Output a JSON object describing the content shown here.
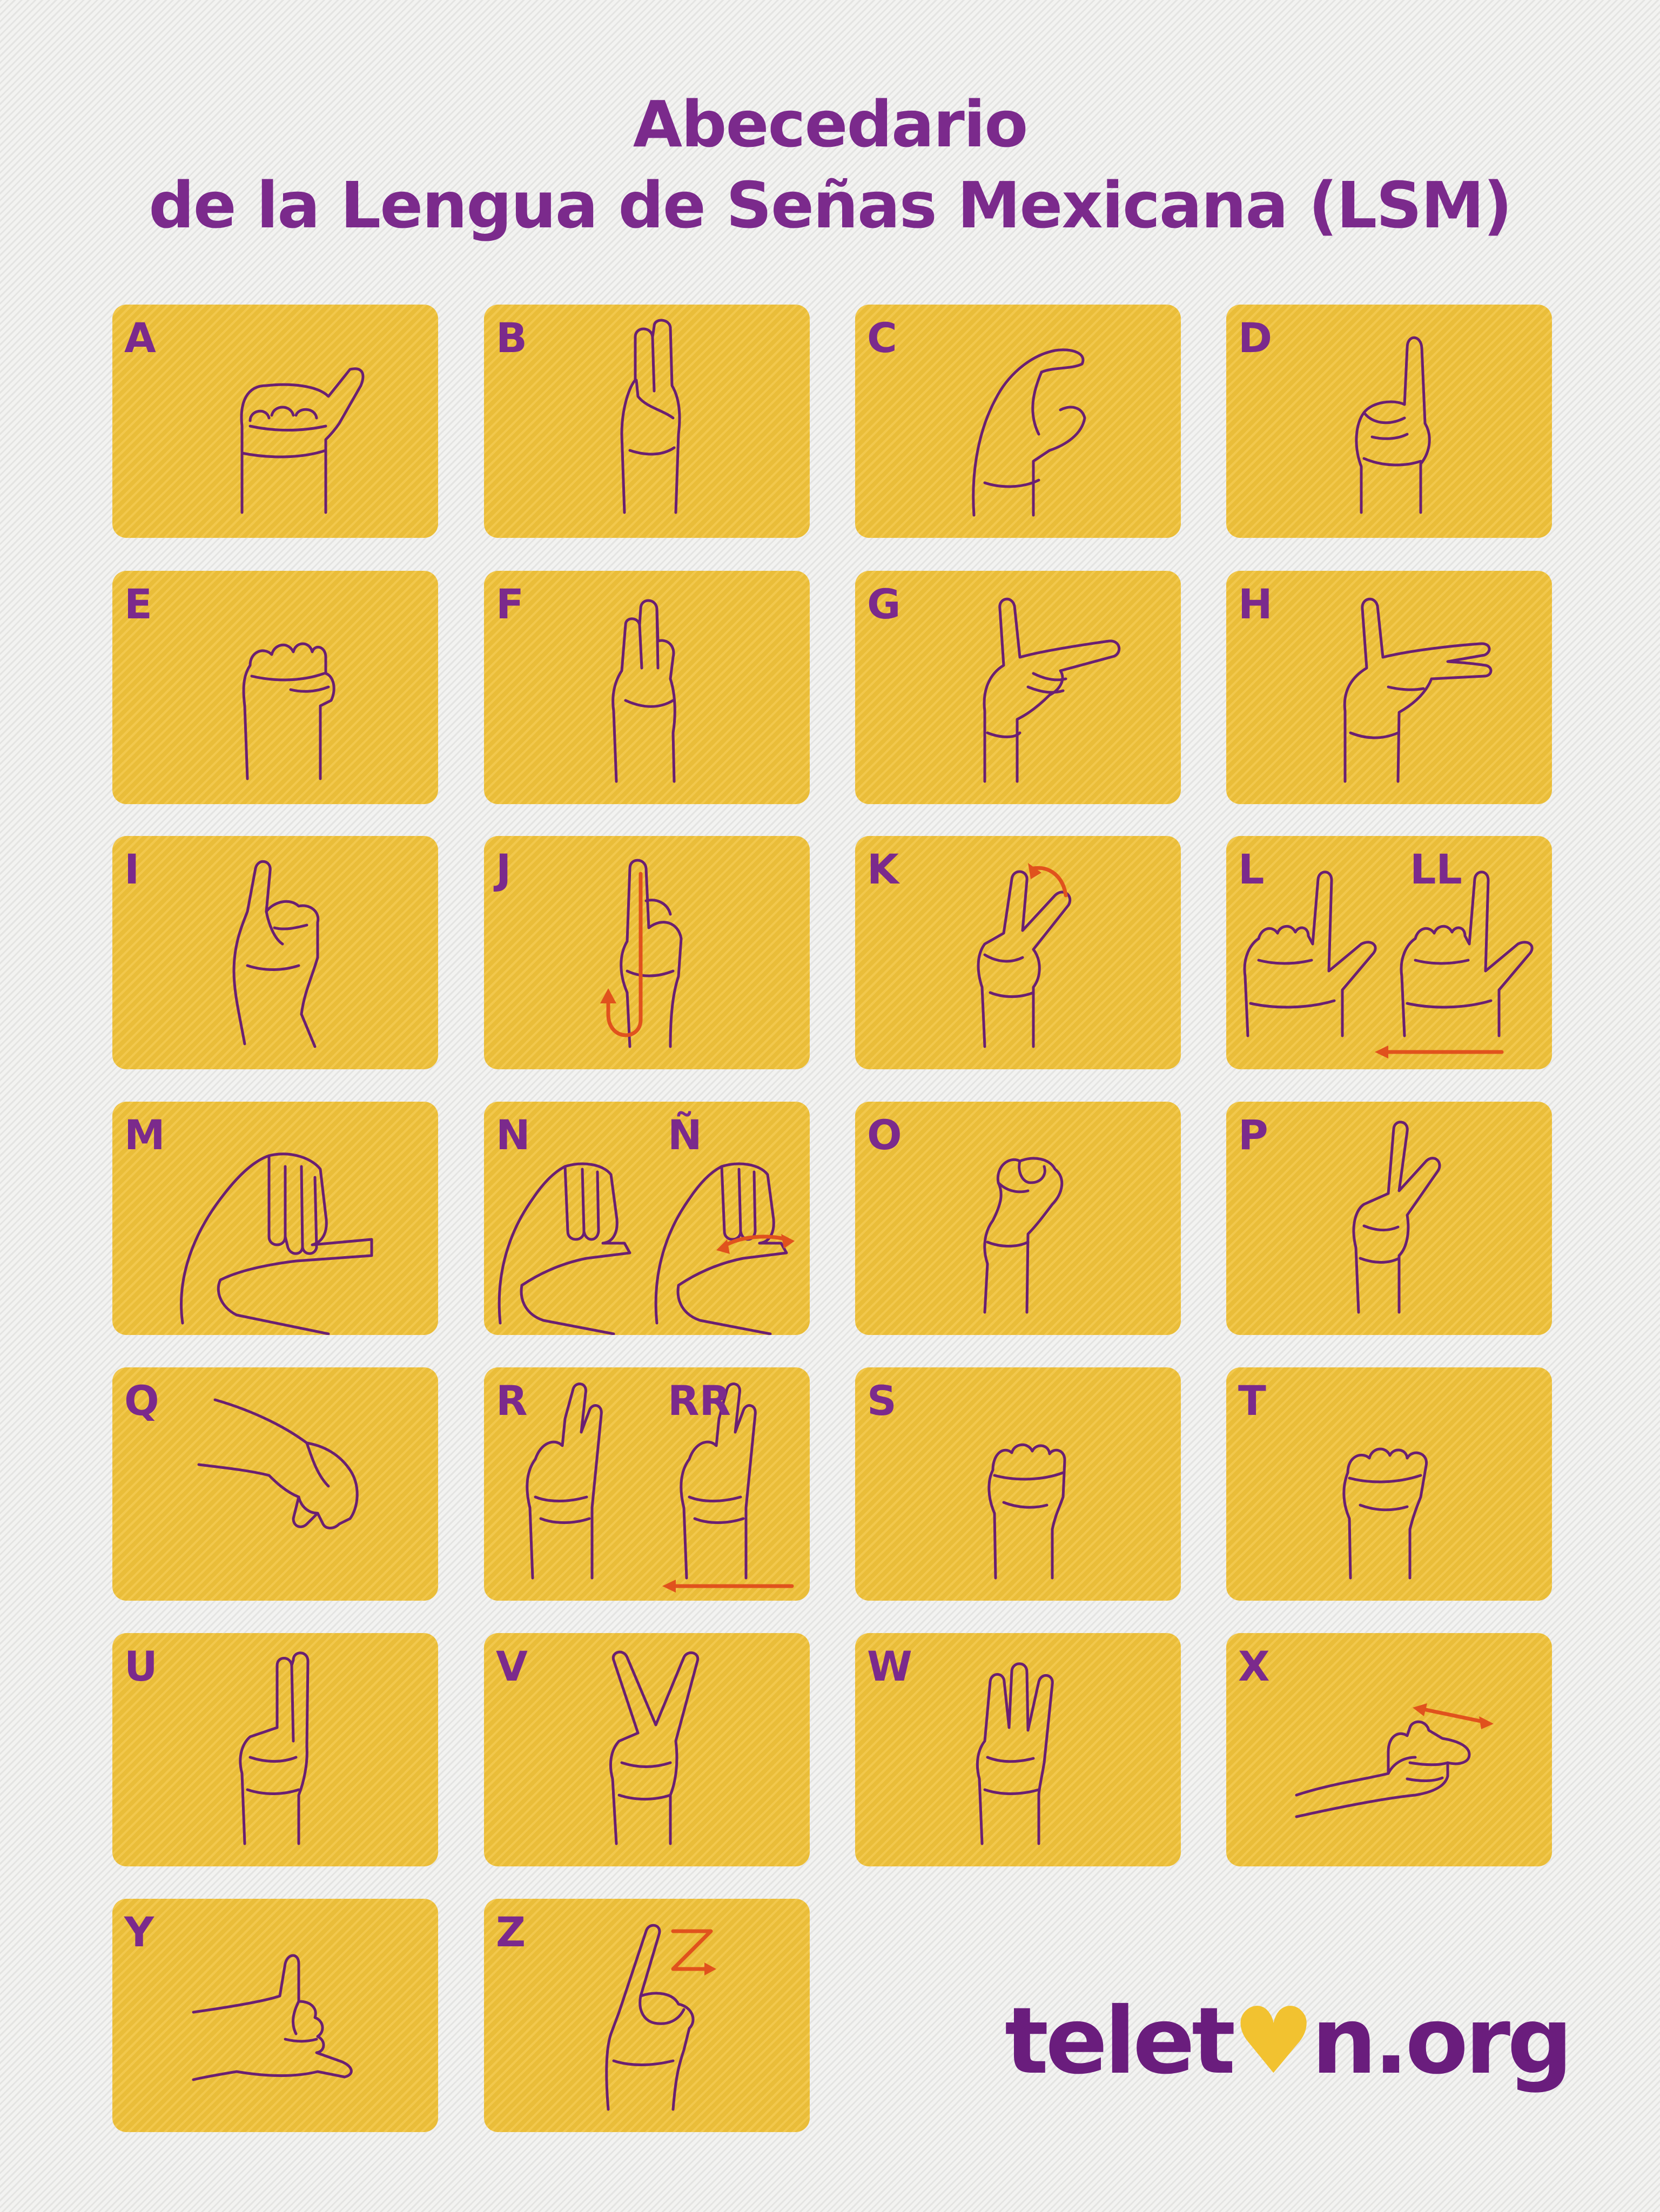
{
  "title": {
    "line1": "Abecedario",
    "line2": "de la Lengua de Señas Mexicana (LSM)"
  },
  "colors": {
    "title": "#7b2a8c",
    "card": "#f1c33b",
    "line": "#6a1f72",
    "arrow": "#e0521d",
    "logo": "#6a1d7d",
    "logo_heart": "#f2c230"
  },
  "cards": [
    {
      "id": "a",
      "labels": [
        "A"
      ],
      "icon": "hand-a-icon"
    },
    {
      "id": "b",
      "labels": [
        "B"
      ],
      "icon": "hand-b-icon"
    },
    {
      "id": "c",
      "labels": [
        "C"
      ],
      "icon": "hand-c-icon"
    },
    {
      "id": "d",
      "labels": [
        "D"
      ],
      "icon": "hand-d-icon"
    },
    {
      "id": "e",
      "labels": [
        "E"
      ],
      "icon": "hand-e-icon"
    },
    {
      "id": "f",
      "labels": [
        "F"
      ],
      "icon": "hand-f-icon"
    },
    {
      "id": "g",
      "labels": [
        "G"
      ],
      "icon": "hand-g-icon"
    },
    {
      "id": "h",
      "labels": [
        "H"
      ],
      "icon": "hand-h-icon"
    },
    {
      "id": "i",
      "labels": [
        "I"
      ],
      "icon": "hand-i-icon"
    },
    {
      "id": "j",
      "labels": [
        "J"
      ],
      "icon": "hand-j-icon"
    },
    {
      "id": "k",
      "labels": [
        "K"
      ],
      "icon": "hand-k-icon"
    },
    {
      "id": "l",
      "labels": [
        "L",
        "LL"
      ],
      "icon": "hand-l-icon"
    },
    {
      "id": "m",
      "labels": [
        "M"
      ],
      "icon": "hand-m-icon"
    },
    {
      "id": "n",
      "labels": [
        "N",
        "Ñ"
      ],
      "icon": "hand-n-icon"
    },
    {
      "id": "o",
      "labels": [
        "O"
      ],
      "icon": "hand-o-icon"
    },
    {
      "id": "p",
      "labels": [
        "P"
      ],
      "icon": "hand-p-icon"
    },
    {
      "id": "q",
      "labels": [
        "Q"
      ],
      "icon": "hand-q-icon"
    },
    {
      "id": "r",
      "labels": [
        "R",
        "RR"
      ],
      "icon": "hand-r-icon"
    },
    {
      "id": "s",
      "labels": [
        "S"
      ],
      "icon": "hand-s-icon"
    },
    {
      "id": "t",
      "labels": [
        "T"
      ],
      "icon": "hand-t-icon"
    },
    {
      "id": "u",
      "labels": [
        "U"
      ],
      "icon": "hand-u-icon"
    },
    {
      "id": "v",
      "labels": [
        "V"
      ],
      "icon": "hand-v-icon"
    },
    {
      "id": "w",
      "labels": [
        "W"
      ],
      "icon": "hand-w-icon"
    },
    {
      "id": "x",
      "labels": [
        "X"
      ],
      "icon": "hand-x-icon"
    },
    {
      "id": "y",
      "labels": [
        "Y"
      ],
      "icon": "hand-y-icon"
    },
    {
      "id": "z",
      "labels": [
        "Z"
      ],
      "icon": "hand-z-icon"
    }
  ],
  "logo": {
    "part1": "telet",
    "heart": "♥",
    "part2": "n.org"
  }
}
